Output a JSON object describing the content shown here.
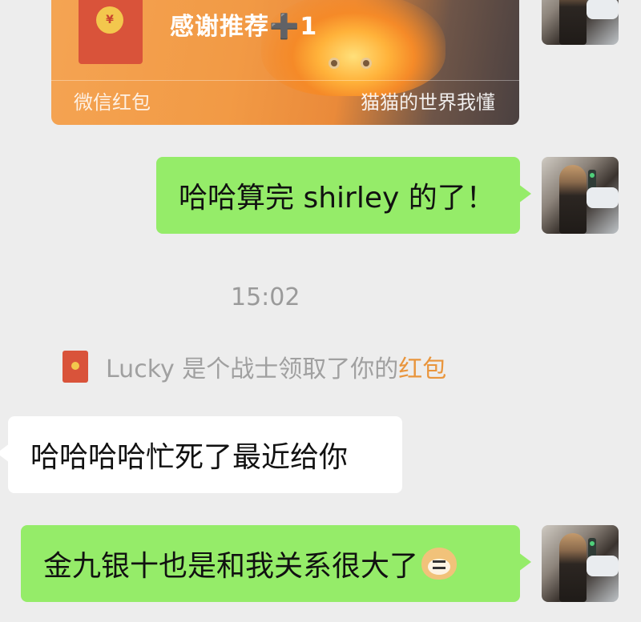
{
  "red_packet": {
    "coin_symbol": "¥",
    "title": "感谢推荐➕1",
    "label": "微信红包",
    "sender_note": "猫猫的世界我懂"
  },
  "messages": [
    {
      "side": "right",
      "text": "哈哈算完 shirley 的了！"
    }
  ],
  "timestamp": "15:02",
  "system_notice": {
    "prefix": "Lucky 是个战士领取了你的",
    "link": "红包"
  },
  "incoming": {
    "text": "哈哈哈哈忙死了最近给你"
  },
  "outgoing_last": {
    "text": "金九银十也是和我关系很大了",
    "emoji": "doge-emoji"
  },
  "colors": {
    "background": "#ededed",
    "sent_bubble": "#95ec69",
    "received_bubble": "#ffffff",
    "red_packet_link": "#e9953c",
    "timestamp": "#9a9a9a"
  }
}
